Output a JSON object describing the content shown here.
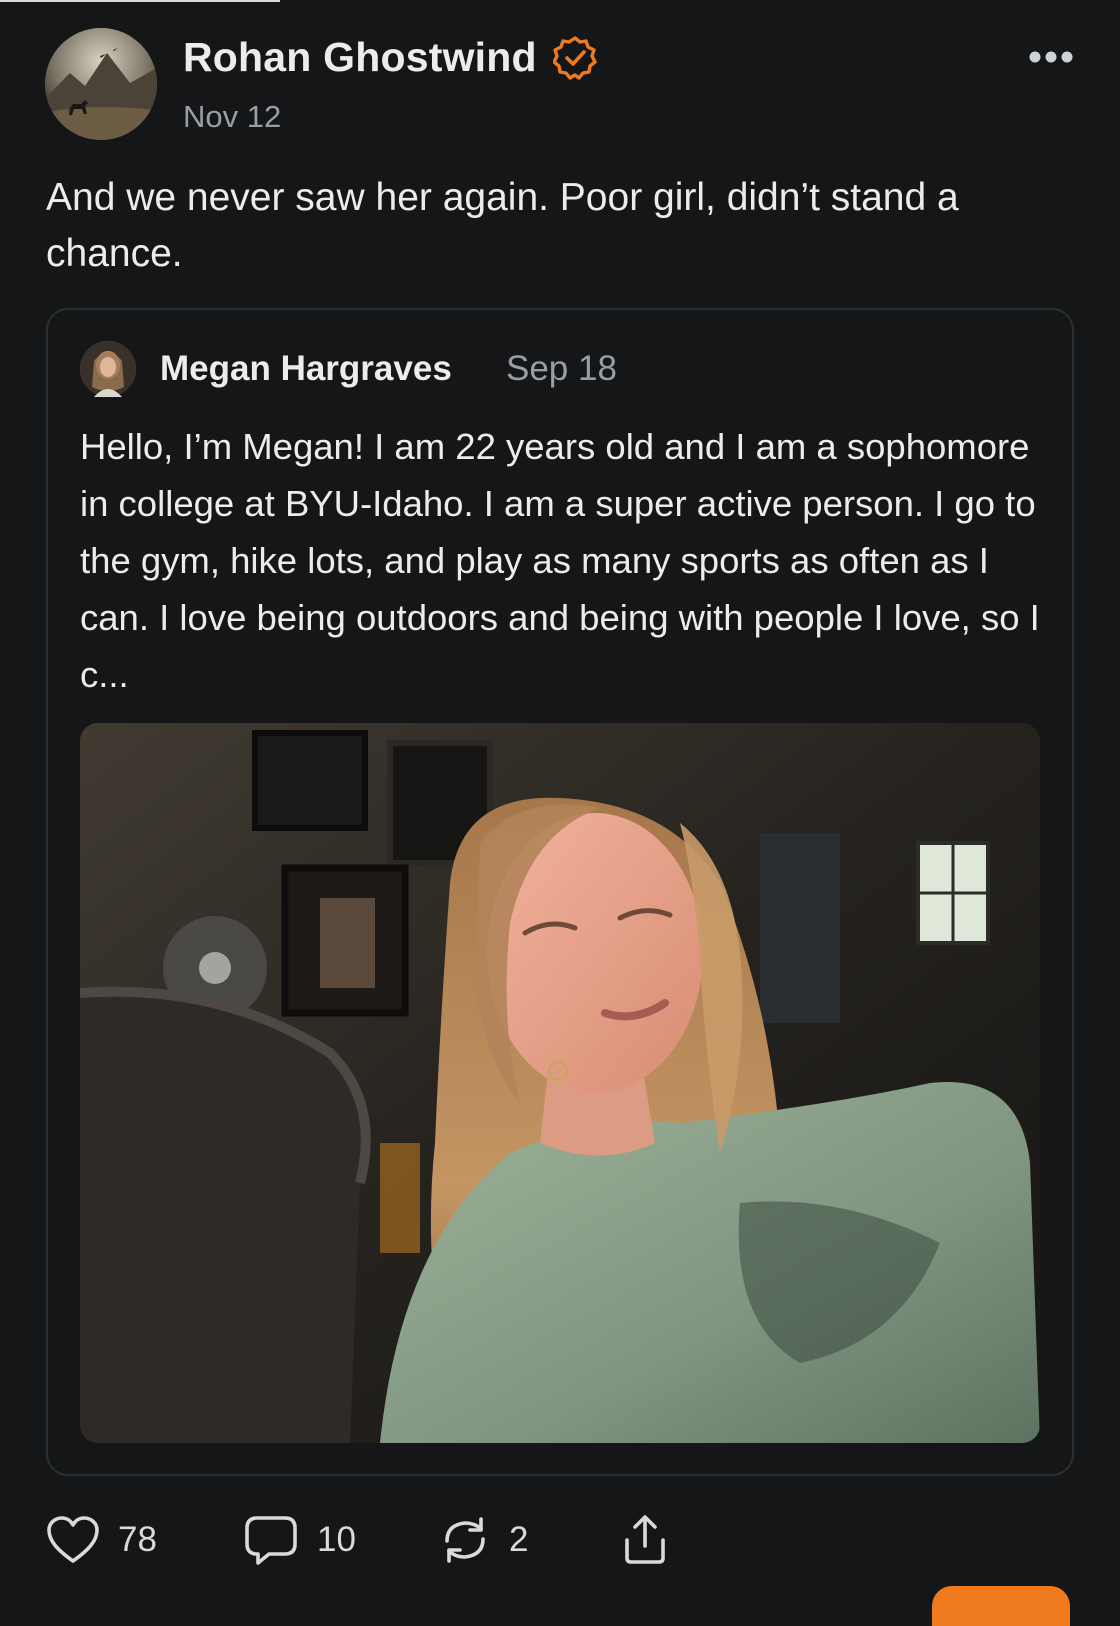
{
  "post": {
    "author": "Rohan Ghostwind",
    "date": "Nov 12",
    "text": "And we never saw her again. Poor girl, didn’t stand a chance."
  },
  "quoted_post": {
    "author": "Megan Hargraves",
    "date": "Sep 18",
    "text": "Hello, I’m Megan! I am 22 years old and I am a sophomore in college at BYU-Idaho. I am a super active person. I go to the gym, hike lots, and play as many sports as often as I can. I love being outdoors and being with people I love, so I c..."
  },
  "actions": {
    "likes": "78",
    "comments": "10",
    "reposts": "2"
  },
  "colors": {
    "background": "#141617",
    "verified": "#f07b1f",
    "accent": "#f07b1f"
  },
  "icons": {
    "verified": "verified-badge-icon",
    "more": "more-dots-icon",
    "like": "heart-icon",
    "comment": "comment-bubble-icon",
    "repost": "repost-icon",
    "share": "share-icon"
  }
}
